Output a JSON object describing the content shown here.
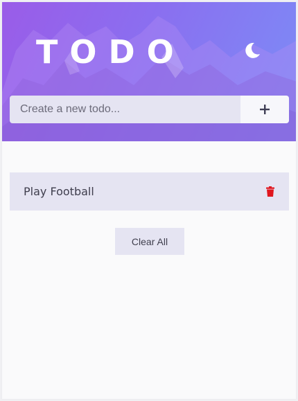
{
  "header": {
    "title": "TODO",
    "theme_icon": "moon-icon"
  },
  "new_todo": {
    "placeholder": "Create a new todo...",
    "value": "",
    "add_icon": "plus-icon"
  },
  "todos": [
    {
      "text": "Play Football",
      "delete_icon": "trash-icon"
    }
  ],
  "actions": {
    "clear_all_label": "Clear All"
  },
  "colors": {
    "gradient_start": "#9a5ce8",
    "gradient_end": "#7c8df6",
    "input_bg": "#e5e4f2",
    "delete_red": "#e0161e",
    "page_bg": "#fafafb"
  }
}
